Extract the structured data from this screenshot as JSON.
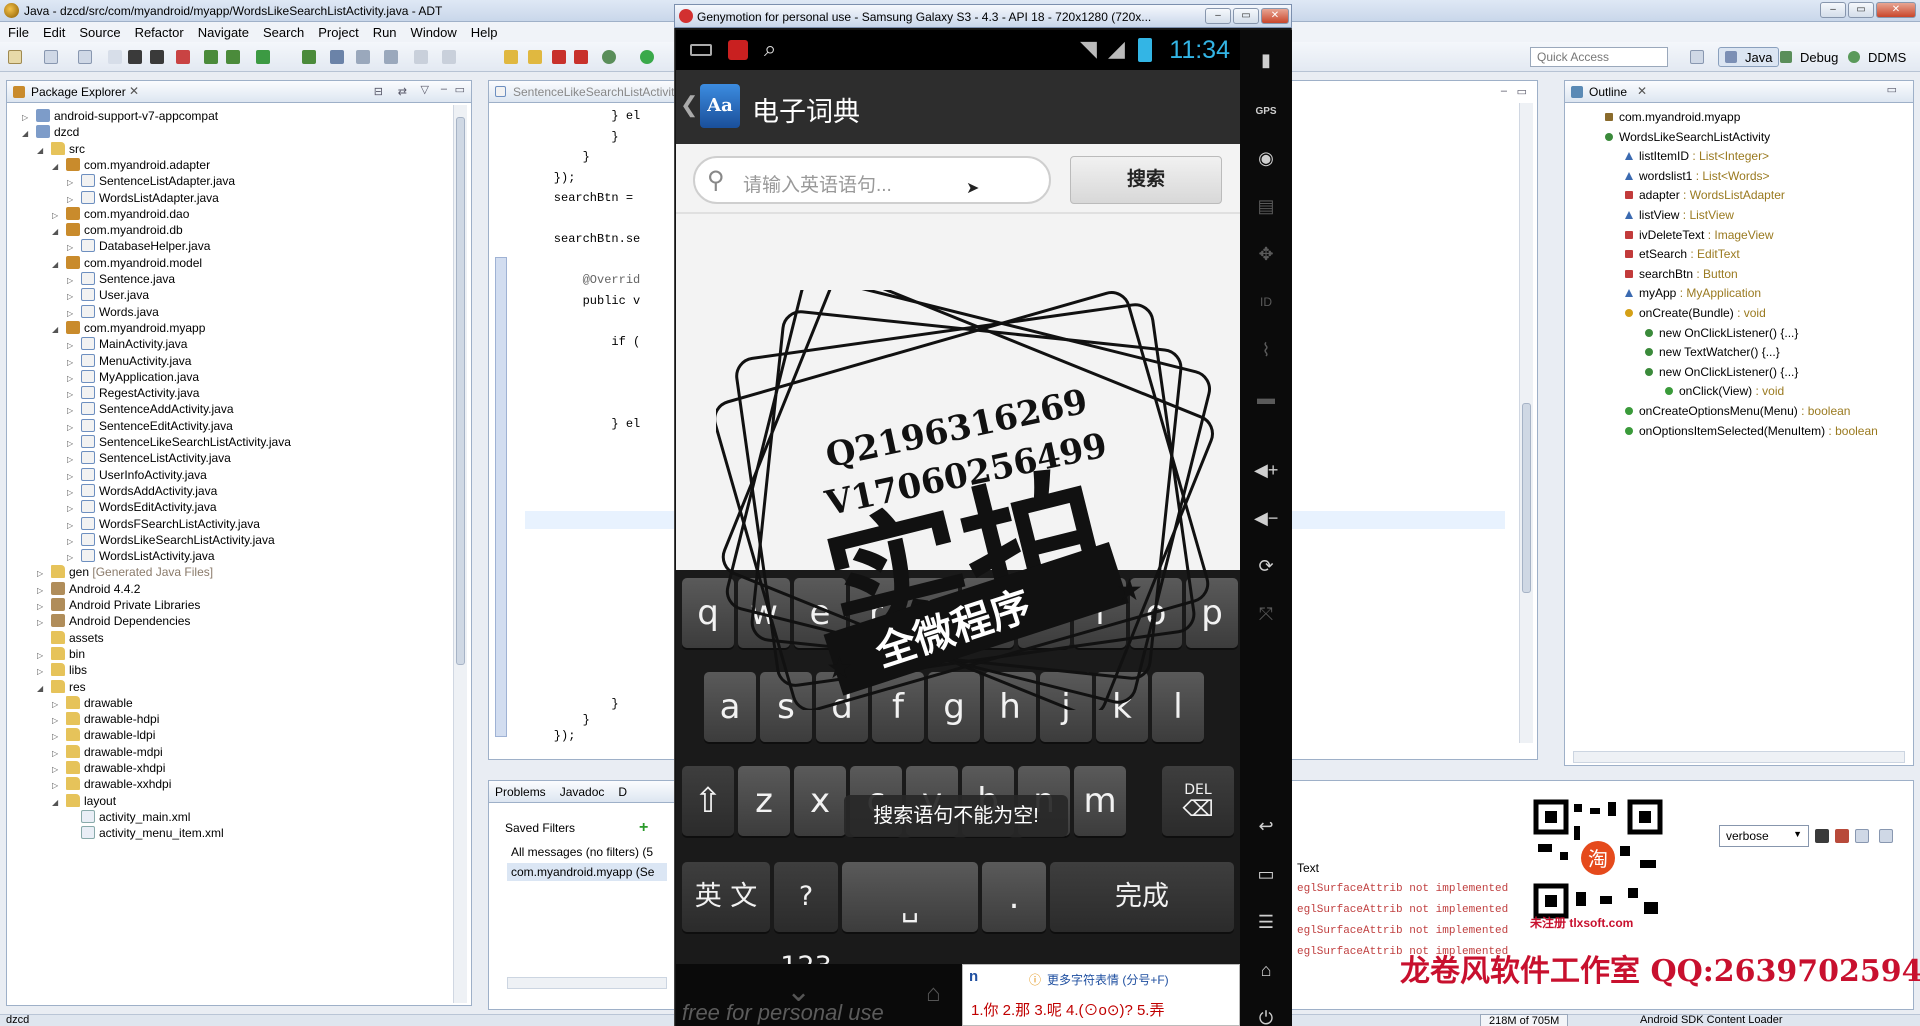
{
  "eclipse": {
    "title": "Java - dzcd/src/com/myandroid/myapp/WordsLikeSearchListActivity.java - ADT",
    "menu": [
      "File",
      "Edit",
      "Source",
      "Refactor",
      "Navigate",
      "Search",
      "Project",
      "Run",
      "Window",
      "Help"
    ],
    "quick_access_placeholder": "Quick Access",
    "perspectives": [
      "Java",
      "Debug",
      "DDMS"
    ],
    "package_explorer": {
      "tab": "Package Explorer",
      "rows": [
        {
          "indent": 1,
          "twisty": "▷",
          "icon": "proj",
          "label": "android-support-v7-appcompat"
        },
        {
          "indent": 1,
          "twisty": "◢",
          "icon": "proj",
          "label": "dzcd"
        },
        {
          "indent": 2,
          "twisty": "◢",
          "icon": "folder",
          "label": "src"
        },
        {
          "indent": 3,
          "twisty": "◢",
          "icon": "pkg",
          "label": "com.myandroid.adapter"
        },
        {
          "indent": 4,
          "twisty": "▷",
          "icon": "java",
          "label": "SentenceListAdapter.java"
        },
        {
          "indent": 4,
          "twisty": "▷",
          "icon": "java",
          "label": "WordsListAdapter.java"
        },
        {
          "indent": 3,
          "twisty": "▷",
          "icon": "pkg",
          "label": "com.myandroid.dao"
        },
        {
          "indent": 3,
          "twisty": "◢",
          "icon": "pkg",
          "label": "com.myandroid.db"
        },
        {
          "indent": 4,
          "twisty": "▷",
          "icon": "java",
          "label": "DatabaseHelper.java"
        },
        {
          "indent": 3,
          "twisty": "◢",
          "icon": "pkg",
          "label": "com.myandroid.model"
        },
        {
          "indent": 4,
          "twisty": "▷",
          "icon": "java",
          "label": "Sentence.java"
        },
        {
          "indent": 4,
          "twisty": "▷",
          "icon": "java",
          "label": "User.java"
        },
        {
          "indent": 4,
          "twisty": "▷",
          "icon": "java",
          "label": "Words.java"
        },
        {
          "indent": 3,
          "twisty": "◢",
          "icon": "pkg",
          "label": "com.myandroid.myapp"
        },
        {
          "indent": 4,
          "twisty": "▷",
          "icon": "java",
          "label": "MainActivity.java"
        },
        {
          "indent": 4,
          "twisty": "▷",
          "icon": "java",
          "label": "MenuActivity.java"
        },
        {
          "indent": 4,
          "twisty": "▷",
          "icon": "java",
          "label": "MyApplication.java"
        },
        {
          "indent": 4,
          "twisty": "▷",
          "icon": "java",
          "label": "RegestActivity.java"
        },
        {
          "indent": 4,
          "twisty": "▷",
          "icon": "java",
          "label": "SentenceAddActivity.java"
        },
        {
          "indent": 4,
          "twisty": "▷",
          "icon": "java",
          "label": "SentenceEditActivity.java"
        },
        {
          "indent": 4,
          "twisty": "▷",
          "icon": "java",
          "label": "SentenceLikeSearchListActivity.java"
        },
        {
          "indent": 4,
          "twisty": "▷",
          "icon": "java",
          "label": "SentenceListActivity.java"
        },
        {
          "indent": 4,
          "twisty": "▷",
          "icon": "java",
          "label": "UserInfoActivity.java"
        },
        {
          "indent": 4,
          "twisty": "▷",
          "icon": "java",
          "label": "WordsAddActivity.java"
        },
        {
          "indent": 4,
          "twisty": "▷",
          "icon": "java",
          "label": "WordsEditActivity.java"
        },
        {
          "indent": 4,
          "twisty": "▷",
          "icon": "java",
          "label": "WordsFSearchListActivity.java"
        },
        {
          "indent": 4,
          "twisty": "▷",
          "icon": "java",
          "label": "WordsLikeSearchListActivity.java"
        },
        {
          "indent": 4,
          "twisty": "▷",
          "icon": "java",
          "label": "WordsListActivity.java"
        },
        {
          "indent": 2,
          "twisty": "▷",
          "icon": "folder",
          "label": "gen",
          "suffix": "[Generated Java Files]"
        },
        {
          "indent": 2,
          "twisty": "▷",
          "icon": "lib",
          "label": "Android 4.4.2"
        },
        {
          "indent": 2,
          "twisty": "▷",
          "icon": "lib",
          "label": "Android Private Libraries"
        },
        {
          "indent": 2,
          "twisty": "▷",
          "icon": "lib",
          "label": "Android Dependencies"
        },
        {
          "indent": 2,
          "twisty": "",
          "icon": "folder",
          "label": "assets"
        },
        {
          "indent": 2,
          "twisty": "▷",
          "icon": "folder",
          "label": "bin"
        },
        {
          "indent": 2,
          "twisty": "▷",
          "icon": "folder",
          "label": "libs"
        },
        {
          "indent": 2,
          "twisty": "◢",
          "icon": "folder",
          "label": "res"
        },
        {
          "indent": 3,
          "twisty": "▷",
          "icon": "folder",
          "label": "drawable"
        },
        {
          "indent": 3,
          "twisty": "▷",
          "icon": "folder",
          "label": "drawable-hdpi"
        },
        {
          "indent": 3,
          "twisty": "▷",
          "icon": "folder",
          "label": "drawable-ldpi"
        },
        {
          "indent": 3,
          "twisty": "▷",
          "icon": "folder",
          "label": "drawable-mdpi"
        },
        {
          "indent": 3,
          "twisty": "▷",
          "icon": "folder",
          "label": "drawable-xhdpi"
        },
        {
          "indent": 3,
          "twisty": "▷",
          "icon": "folder",
          "label": "drawable-xxhdpi"
        },
        {
          "indent": 3,
          "twisty": "◢",
          "icon": "folder",
          "label": "layout"
        },
        {
          "indent": 4,
          "twisty": "",
          "icon": "xml",
          "label": "activity_main.xml"
        },
        {
          "indent": 4,
          "twisty": "",
          "icon": "xml",
          "label": "activity_menu_item.xml"
        }
      ]
    },
    "editor": {
      "tab": "SentenceLikeSearchListActivit",
      "lines": [
        "            } el",
        "            }",
        "        }",
        "    });",
        "    searchBtn =",
        "",
        "    searchBtn.se",
        "",
        "        @Overrid",
        "        public v",
        "",
        "            if (",
        "",
        "",
        "",
        "            } el"
      ],
      "bottom_lines": [
        "            }",
        "        }",
        "    });"
      ]
    },
    "outline": {
      "tab": "Outline",
      "rows": [
        {
          "indent": 1,
          "kind": "pkg",
          "label": "com.myandroid.myapp",
          "type": ""
        },
        {
          "indent": 1,
          "kind": "class",
          "label": "WordsLikeSearchListActivity",
          "type": ""
        },
        {
          "indent": 2,
          "kind": "field-pkg",
          "label": "listItemID",
          "type": " : List<Integer>"
        },
        {
          "indent": 2,
          "kind": "field-pkg",
          "label": "wordslist1",
          "type": " : List<Words>"
        },
        {
          "indent": 2,
          "kind": "field-priv",
          "label": "adapter",
          "type": " : WordsListAdapter"
        },
        {
          "indent": 2,
          "kind": "field-pkg",
          "label": "listView",
          "type": " : ListView"
        },
        {
          "indent": 2,
          "kind": "field-priv",
          "label": "ivDeleteText",
          "type": " : ImageView"
        },
        {
          "indent": 2,
          "kind": "field-priv",
          "label": "etSearch",
          "type": " : EditText"
        },
        {
          "indent": 2,
          "kind": "field-priv",
          "label": "searchBtn",
          "type": " : Button"
        },
        {
          "indent": 2,
          "kind": "field-pkg",
          "label": "myApp",
          "type": " : MyApplication"
        },
        {
          "indent": 2,
          "kind": "method-prot",
          "label": "onCreate(Bundle)",
          "type": " : void"
        },
        {
          "indent": 3,
          "kind": "anon",
          "label": "new OnClickListener() {...}",
          "type": ""
        },
        {
          "indent": 3,
          "kind": "anon",
          "label": "new TextWatcher() {...}",
          "type": ""
        },
        {
          "indent": 3,
          "kind": "anon",
          "label": "new OnClickListener() {...}",
          "type": ""
        },
        {
          "indent": 4,
          "kind": "method",
          "label": "onClick(View)",
          "type": " : void"
        },
        {
          "indent": 2,
          "kind": "method",
          "label": "onCreateOptionsMenu(Menu)",
          "type": " : boolean"
        },
        {
          "indent": 2,
          "kind": "method",
          "label": "onOptionsItemSelected(MenuItem)",
          "type": " : boolean"
        }
      ]
    },
    "problems": {
      "tabs": [
        "Problems",
        "Javadoc",
        "D"
      ],
      "saved_filters": "Saved Filters",
      "filters": [
        "All messages (no filters) (5",
        "com.myandroid.myapp (Se"
      ]
    },
    "logcat": {
      "level": "verbose",
      "header": "Text",
      "lines": [
        "eglSurfaceAttrib not implemented",
        "eglSurfaceAttrib not implemented",
        "eglSurfaceAttrib not implemented",
        "eglSurfaceAttrib not implemented"
      ]
    },
    "statusbar": {
      "left": "dzcd",
      "memory": "218M of 705M",
      "right": "Android SDK Content Loader"
    }
  },
  "genymotion": {
    "title": "Genymotion for personal use - Samsung Galaxy S3 - 4.3 - API 18 - 720x1280 (720x...",
    "status_time": "11:34",
    "app_title": "电子词典",
    "app_icon_text": "Aa",
    "search_placeholder": "请输入英语语句...",
    "search_button": "搜索",
    "toast": "搜索语句不能为空!",
    "keyboard": {
      "row1": [
        "q",
        "w",
        "e",
        "r",
        "t",
        "y",
        "u",
        "i",
        "o",
        "p"
      ],
      "row2": [
        "a",
        "s",
        "d",
        "f",
        "g",
        "h",
        "j",
        "k",
        "l"
      ],
      "row3": [
        "z",
        "x",
        "c",
        "v",
        "b",
        "n",
        "m"
      ],
      "del": "DEL",
      "lang": "英 文",
      "sym": "?123",
      "space": "␣",
      "dot": ".",
      "done": "完成"
    },
    "ime": {
      "typed": "n",
      "hint": "更多字符表情 (分号+F)",
      "candidates": "1.你  2.那  3.呢  4.(⊙o⊙)?  5.弄"
    },
    "free_note": "free for personal use",
    "side_labels": {
      "gps": "GPS",
      "id": "ID"
    }
  },
  "overlay": {
    "stamp_line1": "Q2196316269",
    "stamp_line2": "V17060256499",
    "stamp_big": "实拍",
    "stamp_banner": "全微程序",
    "studio": "龙卷风软件工作室 QQ:2639702594",
    "qr_caption": "未注册 tlxsoft.com"
  },
  "colors": {
    "accent": "#33b5e5",
    "watermark": "#c8102e"
  }
}
